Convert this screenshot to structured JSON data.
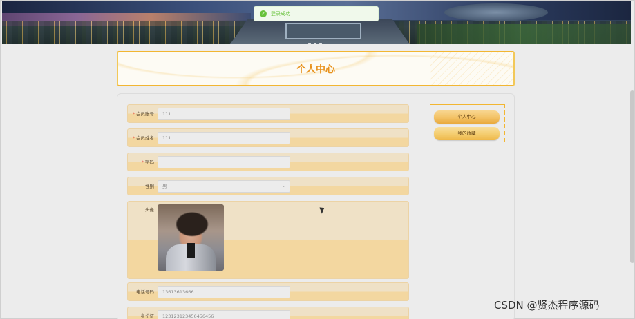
{
  "toast": {
    "icon": "check-circle-icon",
    "message": "登录成功",
    "color": "#67c23a"
  },
  "page_title": "个人中心",
  "form": {
    "fields": [
      {
        "label": "会员账号",
        "required": true,
        "value": "111"
      },
      {
        "label": "会员姓名",
        "required": true,
        "value": "111"
      },
      {
        "label": "密码",
        "required": true,
        "value": "···"
      },
      {
        "label": "性别",
        "required": false,
        "value": "男",
        "type": "select"
      },
      {
        "label": "头像",
        "required": false,
        "type": "image"
      },
      {
        "label": "电话号码",
        "required": false,
        "value": "13613613666"
      },
      {
        "label": "身份证",
        "required": false,
        "value": "123123123456456456"
      }
    ]
  },
  "side_menu": {
    "items": [
      "个人中心",
      "我的收藏"
    ]
  },
  "watermark": "CSDN @贤杰程序源码",
  "colors": {
    "accent": "#f2b632",
    "title": "#e8911c",
    "row_light": "#efe1c6",
    "row_dark": "#f3d7a0"
  }
}
